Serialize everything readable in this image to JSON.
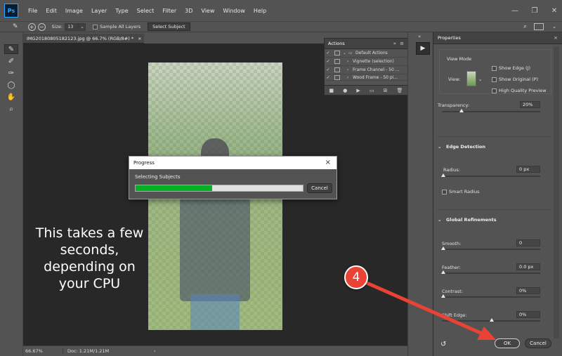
{
  "menubar": {
    "logo": "Ps",
    "items": [
      "File",
      "Edit",
      "Image",
      "Layer",
      "Type",
      "Select",
      "Filter",
      "3D",
      "View",
      "Window",
      "Help"
    ]
  },
  "options": {
    "size_label": "Size:",
    "size_value": "13",
    "sample_all_layers": "Sample All Layers",
    "select_subject": "Select Subject"
  },
  "document": {
    "tab_title": "IMG20180805182123.jpg @ 66.7% (RGB/8#) *",
    "tab_close": "×"
  },
  "caption": "This takes a few seconds, depending on your CPU",
  "statusbar": {
    "zoom": "66.67%",
    "doc": "Doc: 1.21M/1.21M",
    "arrow": "›"
  },
  "actions_panel": {
    "title": "Actions",
    "rows": [
      {
        "check": "✓",
        "label": "Default Actions",
        "caret": "⌄"
      },
      {
        "check": "✓",
        "label": "Vignette (selection)",
        "caret": "›"
      },
      {
        "check": "✓",
        "label": "Frame Channel - 50 ...",
        "caret": "›"
      },
      {
        "check": "✓",
        "label": "Wood Frame - 50 pi...",
        "caret": "›"
      }
    ]
  },
  "properties": {
    "title": "Properties",
    "view_mode": "View Mode",
    "view_label": "View:",
    "show_edge": "Show Edge (J)",
    "show_original": "Show Original (P)",
    "high_quality_preview": "High Quality Preview",
    "transparency_label": "Transparency:",
    "transparency_value": "20%",
    "transparency_level": 0.2,
    "edge_detection": "Edge Detection",
    "radius_label": "Radius:",
    "radius_value": "0 px",
    "smart_radius": "Smart Radius",
    "global_refinements": "Global Refinements",
    "smooth_label": "Smooth:",
    "smooth_value": "0",
    "feather_label": "Feather:",
    "feather_value": "0.0 px",
    "contrast_label": "Contrast:",
    "contrast_value": "0%",
    "shift_edge_label": "Shift Edge:",
    "shift_edge_value": "0%",
    "ok": "OK",
    "cancel": "Cancel"
  },
  "progress_dialog": {
    "title": "Progress",
    "close": "×",
    "status": "Selecting Subjects",
    "progress": 0.46,
    "cancel": "Cancel"
  },
  "annotation": {
    "step": "4",
    "color": "#ea4335"
  },
  "colors": {
    "ps_blue": "#31a8ff",
    "progress_green": "#06b025",
    "ui_gray": "#535353"
  }
}
